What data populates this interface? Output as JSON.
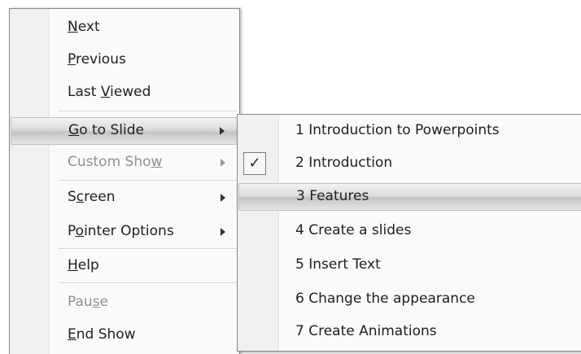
{
  "main_menu": {
    "items": [
      {
        "pre": "",
        "key": "N",
        "post": "ext",
        "disabled": false,
        "submenu": false
      },
      {
        "pre": "",
        "key": "P",
        "post": "revious",
        "disabled": false,
        "submenu": false
      },
      {
        "pre": "Last ",
        "key": "V",
        "post": "iewed",
        "disabled": false,
        "submenu": false
      },
      {
        "pre": "",
        "key": "G",
        "post": "o to Slide",
        "disabled": false,
        "submenu": true,
        "highlighted": true
      },
      {
        "pre": "Custom Sho",
        "key": "w",
        "post": "",
        "disabled": true,
        "submenu": true
      },
      {
        "pre": "S",
        "key": "c",
        "post": "reen",
        "disabled": false,
        "submenu": true
      },
      {
        "pre": "P",
        "key": "o",
        "post": "inter Options",
        "disabled": false,
        "submenu": true
      },
      {
        "pre": "",
        "key": "H",
        "post": "elp",
        "disabled": false,
        "submenu": false
      },
      {
        "pre": "Pau",
        "key": "s",
        "post": "e",
        "disabled": true,
        "submenu": false
      },
      {
        "pre": "",
        "key": "E",
        "post": "nd Show",
        "disabled": false,
        "submenu": false
      }
    ]
  },
  "slides_menu": {
    "check_glyph": "✓",
    "items": [
      {
        "label": "1 Introduction to Powerpoints",
        "checked": false
      },
      {
        "label": "2 Introduction",
        "checked": true
      },
      {
        "label": "3 Features",
        "checked": false,
        "highlighted": true
      },
      {
        "label": "4 Create a slides",
        "checked": false
      },
      {
        "label": "5 Insert Text",
        "checked": false
      },
      {
        "label": "6 Change the appearance",
        "checked": false
      },
      {
        "label": "7 Create Animations",
        "checked": false
      }
    ]
  }
}
